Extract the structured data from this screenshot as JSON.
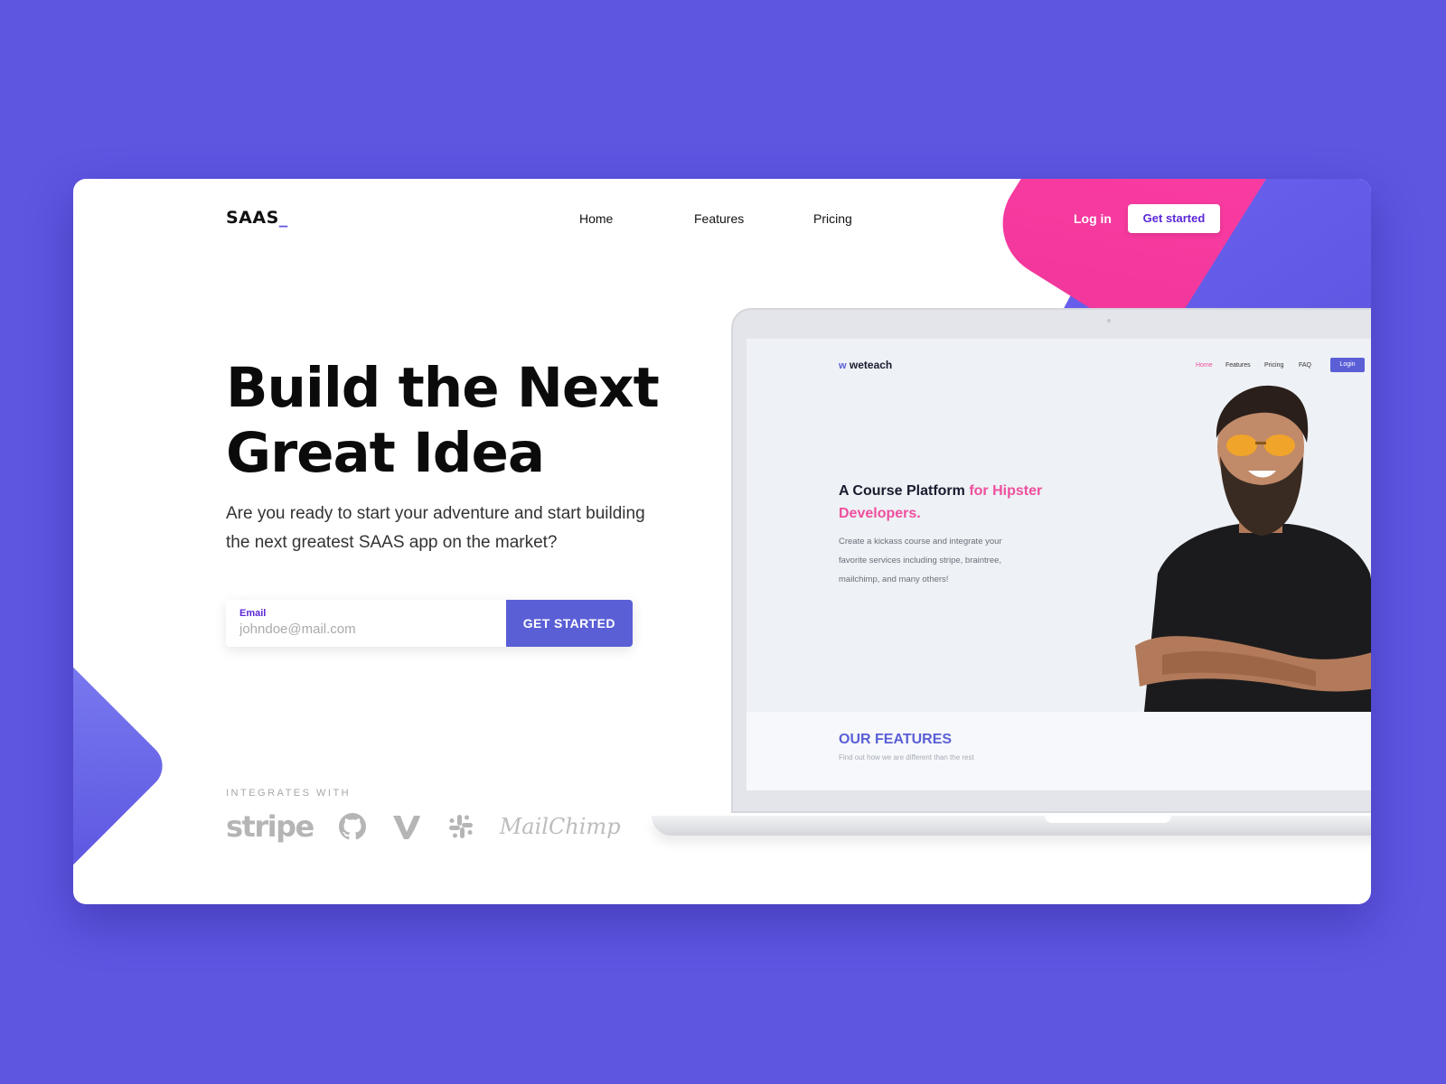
{
  "header": {
    "logo_text": "SAAS",
    "logo_cursor": "_",
    "nav": [
      {
        "label": "Home"
      },
      {
        "label": "Features"
      },
      {
        "label": "Pricing"
      }
    ],
    "login_label": "Log in",
    "get_started_label": "Get started"
  },
  "hero": {
    "title_line1": "Build the Next",
    "title_line2": "Great Idea",
    "subtitle": "Are you ready to start your adventure and start building the next greatest SAAS app on the market?",
    "email_label": "Email",
    "email_placeholder": "johndoe@mail.com",
    "cta_label": "GET STARTED"
  },
  "integrations": {
    "label": "INTEGRATES WITH",
    "logos": [
      {
        "name": "stripe",
        "text": "stripe",
        "icon": "stripe-logo"
      },
      {
        "name": "github",
        "icon": "github-icon"
      },
      {
        "name": "vimeo",
        "icon": "vimeo-icon"
      },
      {
        "name": "slack",
        "icon": "slack-icon"
      },
      {
        "name": "mailchimp",
        "text": "MailChimp",
        "icon": "mailchimp-logo"
      }
    ]
  },
  "laptop_screen": {
    "logo_text": "weteach",
    "nav": [
      {
        "label": "Home"
      },
      {
        "label": "Features"
      },
      {
        "label": "Pricing"
      },
      {
        "label": "FAQ"
      }
    ],
    "login_label": "Login",
    "title_dark": "A Course Platform",
    "title_pink": "for Hipster Developers.",
    "body_text": "Create a kickass course and integrate your favorite services including stripe, braintree, mailchimp, and many others!",
    "features_title": "OUR FEATURES",
    "features_sub": "Find out how we are different than the rest"
  },
  "colors": {
    "background": "#5e55e1",
    "accent": "#5a5fd6",
    "pink": "#f0379b",
    "label_purple": "#5b27d9"
  }
}
